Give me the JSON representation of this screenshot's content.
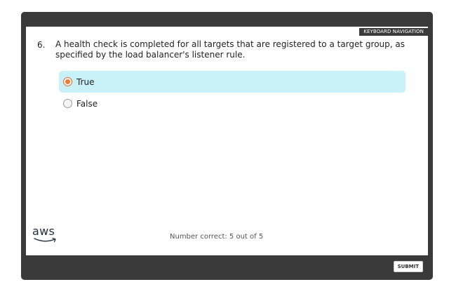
{
  "header": {
    "keyboard_navigation": "KEYBOARD NAVIGATION"
  },
  "question": {
    "number": "6.",
    "text": "A health check is completed for all targets that are registered to a target group, as specified by the load balancer's listener rule."
  },
  "options": [
    {
      "label": "True",
      "selected": true
    },
    {
      "label": "False",
      "selected": false
    }
  ],
  "footer": {
    "logo": "aws",
    "score": "Number correct: 5 out of 5",
    "submit_label": "SUBMIT"
  },
  "colors": {
    "frame": "#3a3a3a",
    "selected_bg": "#c9f2f8",
    "radio_selected": "#f0792f"
  }
}
